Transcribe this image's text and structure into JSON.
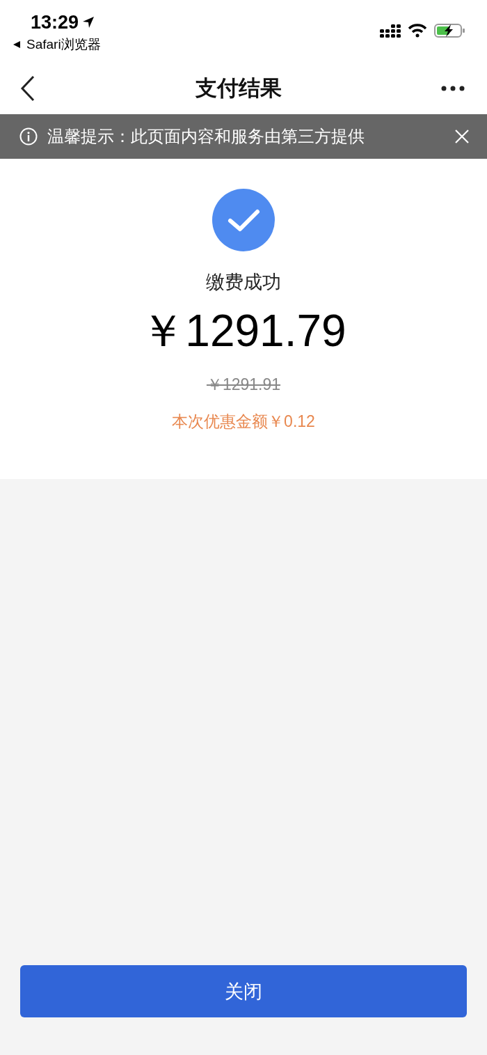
{
  "status_bar": {
    "time": "13:29",
    "back_app": "Safari浏览器"
  },
  "nav": {
    "title": "支付结果"
  },
  "notice": {
    "text": "温馨提示：此页面内容和服务由第三方提供"
  },
  "result": {
    "status": "缴费成功",
    "amount": "￥1291.79",
    "original_amount": "￥1291.91",
    "discount": "本次优惠金额￥0.12"
  },
  "buttons": [
    {
      "label": "关闭"
    }
  ]
}
